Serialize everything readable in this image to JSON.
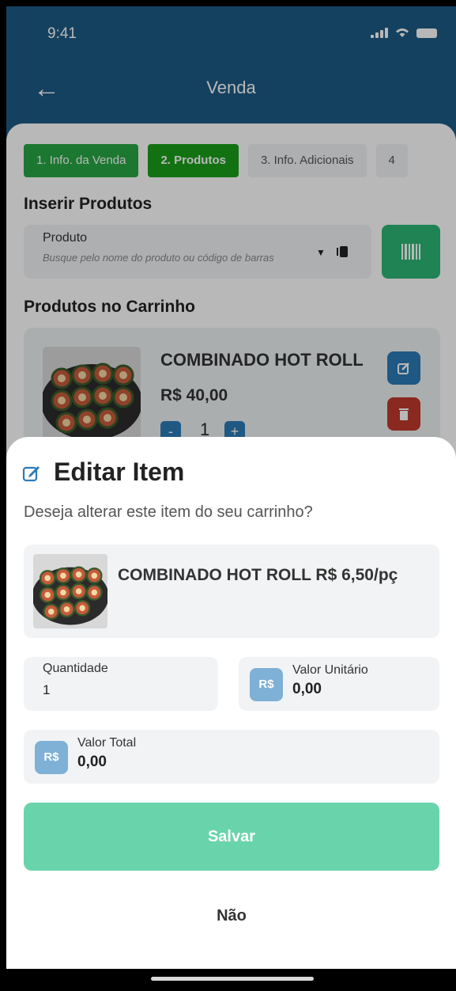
{
  "status_bar": {
    "time": "9:41"
  },
  "header": {
    "title": "Venda"
  },
  "steps": [
    {
      "label": "1. Info. da Venda"
    },
    {
      "label": "2. Produtos"
    },
    {
      "label": "3. Info. Adicionais"
    },
    {
      "label": "4"
    }
  ],
  "insert": {
    "section_title": "Inserir Produtos",
    "field_label": "Produto",
    "field_placeholder": "Busque pelo nome do produto ou código de barras"
  },
  "cart": {
    "section_title": "Produtos no Carrinho",
    "item": {
      "name": "COMBINADO HOT ROLL",
      "price": "R$ 40,00",
      "qty_minus": "-",
      "qty": "1",
      "qty_plus": "+"
    }
  },
  "sheet": {
    "title": "Editar Item",
    "subtitle": "Deseja alterar este item do seu carrinho?",
    "item_text": "COMBINADO HOT ROLL R$ 6,50/pç",
    "quantity_label": "Quantidade",
    "quantity_value": "1",
    "unit_value_label": "Valor Unitário",
    "unit_value": "0,00",
    "total_label": "Valor Total",
    "total_value": "0,00",
    "currency_badge": "R$",
    "save_label": "Salvar",
    "no_label": "Não"
  },
  "colors": {
    "header_bg": "#1e5b86",
    "step_done": "#28a745",
    "step_active": "#1a9e1a",
    "primary": "#2c7bb6",
    "danger": "#c0392b",
    "save_button": "#69d4ac",
    "badge": "#7fb0d6"
  }
}
